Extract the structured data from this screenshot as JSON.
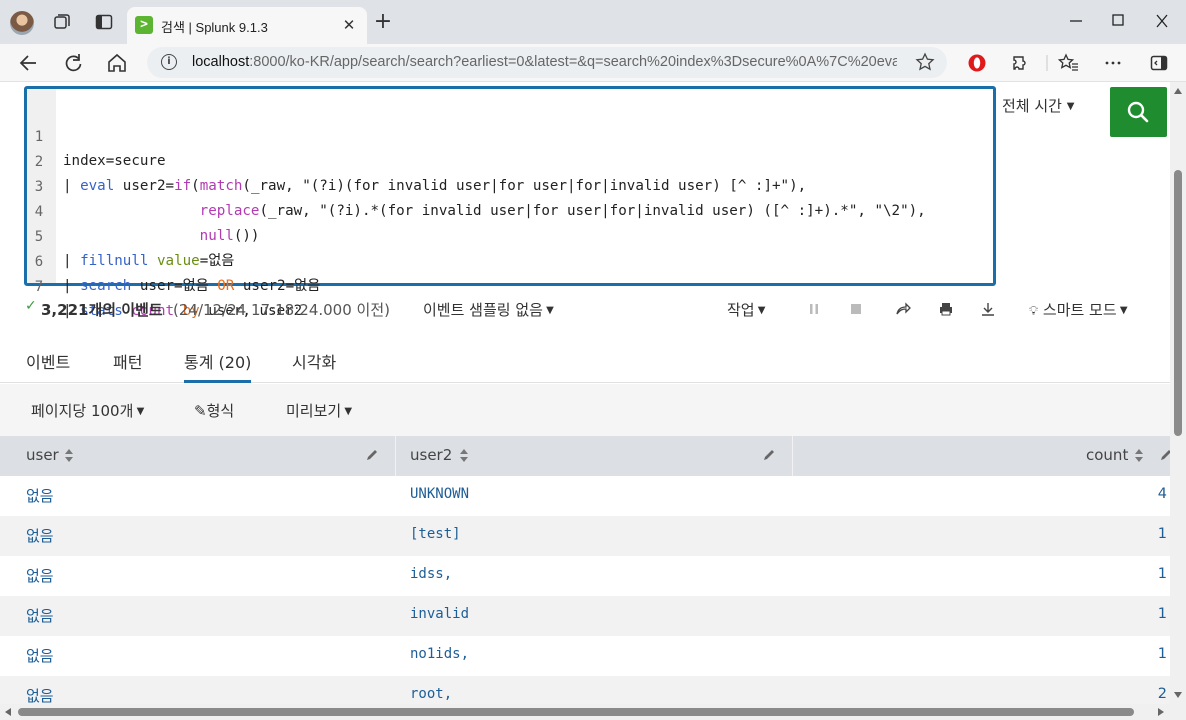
{
  "browser": {
    "tab_title": "검색 | Splunk 9.1.3",
    "tab_favicon": ">",
    "url_host": "localhost",
    "url_rest": ":8000/ko-KR/app/search/search?earliest=0&latest=&q=search%20index%3Dsecure%0A%7C%20eval%2..."
  },
  "editor": {
    "line_numbers": [
      "1",
      "2",
      "3",
      "4",
      "5",
      "6",
      "7"
    ]
  },
  "search": {
    "time_picker": "전체 시간",
    "search_icon": "search-icon"
  },
  "status": {
    "event_count": "3,221개의 이벤트",
    "event_time": "(24/12/24 17:18:24.000 이전)",
    "sampling": "이벤트 샘플링 없음",
    "job_menu": "작업",
    "smart_mode": "스마트 모드"
  },
  "tabs": [
    "이벤트",
    "패턴",
    "통계 (20)",
    "시각화"
  ],
  "results_toolbar": {
    "per_page": "페이지당 100개",
    "format": "형식",
    "preview": "미리보기"
  },
  "table": {
    "headers": [
      "user",
      "user2",
      "count"
    ],
    "rows": [
      {
        "user": "없음",
        "user2": "UNKNOWN",
        "count": "4"
      },
      {
        "user": "없음",
        "user2": "[test]",
        "count": "1"
      },
      {
        "user": "없음",
        "user2": "idss,",
        "count": "1"
      },
      {
        "user": "없음",
        "user2": "invalid",
        "count": "1"
      },
      {
        "user": "없음",
        "user2": "no1ids,",
        "count": "1"
      },
      {
        "user": "없음",
        "user2": "root,",
        "count": "2"
      }
    ]
  },
  "colors": {
    "accent": "#1a6ea9",
    "search_button": "#1e8c2f",
    "link_text": "#1e5e96"
  }
}
